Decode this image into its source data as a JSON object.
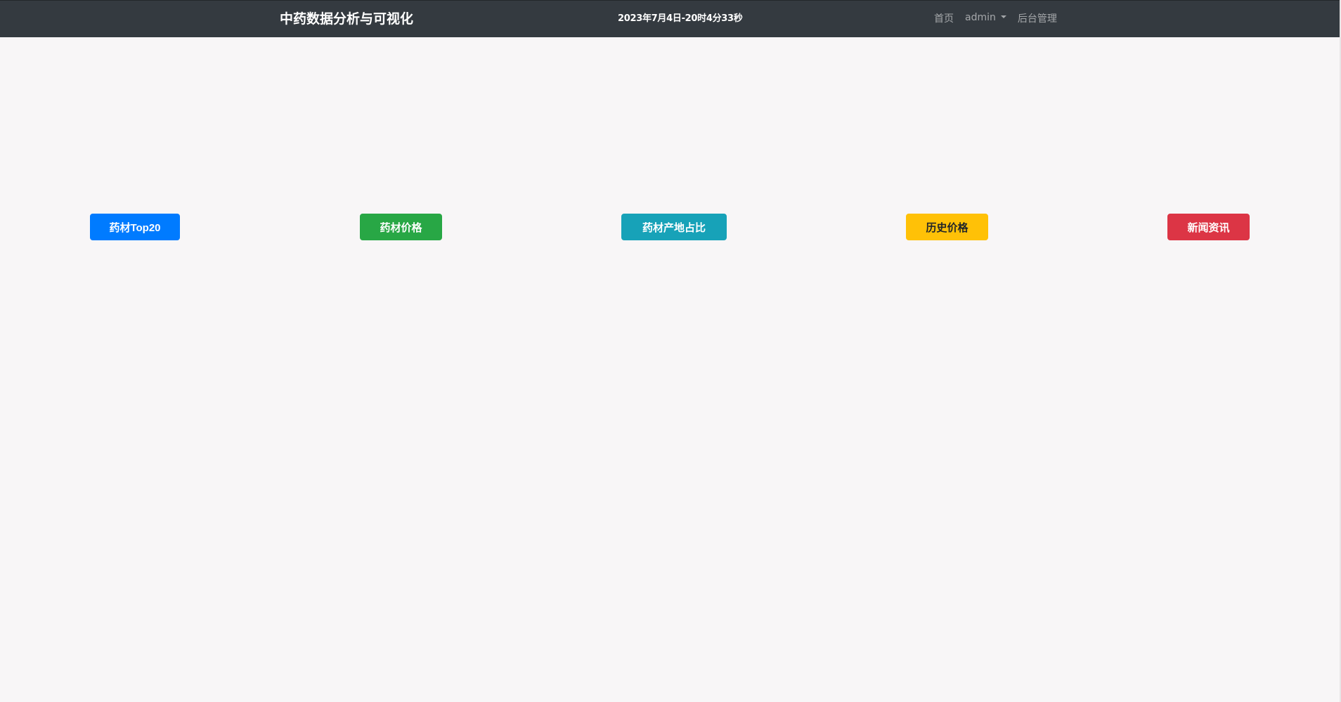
{
  "navbar": {
    "brand": "中药数据分析与可视化",
    "datetime": "2023年7月4日-20时4分33秒",
    "links": {
      "home": "首页",
      "user": "admin",
      "admin_panel": "后台管理"
    }
  },
  "actions": {
    "top20": "药材Top20",
    "price": "药材价格",
    "origin_ratio": "药材产地占比",
    "history_price": "历史价格",
    "news": "新闻资讯"
  },
  "colors": {
    "navbar_bg": "#343a40",
    "page_bg": "#f8f6f7",
    "primary": "#007bff",
    "success": "#28a745",
    "info": "#17a2b8",
    "warning": "#ffc107",
    "danger": "#dc3545"
  }
}
